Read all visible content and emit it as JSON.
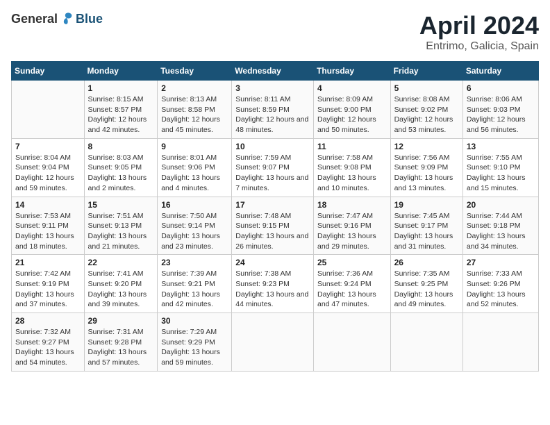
{
  "header": {
    "logo_general": "General",
    "logo_blue": "Blue",
    "title": "April 2024",
    "subtitle": "Entrimo, Galicia, Spain"
  },
  "columns": [
    "Sunday",
    "Monday",
    "Tuesday",
    "Wednesday",
    "Thursday",
    "Friday",
    "Saturday"
  ],
  "weeks": [
    [
      {
        "num": "",
        "sunrise": "",
        "sunset": "",
        "daylight": ""
      },
      {
        "num": "1",
        "sunrise": "Sunrise: 8:15 AM",
        "sunset": "Sunset: 8:57 PM",
        "daylight": "Daylight: 12 hours and 42 minutes."
      },
      {
        "num": "2",
        "sunrise": "Sunrise: 8:13 AM",
        "sunset": "Sunset: 8:58 PM",
        "daylight": "Daylight: 12 hours and 45 minutes."
      },
      {
        "num": "3",
        "sunrise": "Sunrise: 8:11 AM",
        "sunset": "Sunset: 8:59 PM",
        "daylight": "Daylight: 12 hours and 48 minutes."
      },
      {
        "num": "4",
        "sunrise": "Sunrise: 8:09 AM",
        "sunset": "Sunset: 9:00 PM",
        "daylight": "Daylight: 12 hours and 50 minutes."
      },
      {
        "num": "5",
        "sunrise": "Sunrise: 8:08 AM",
        "sunset": "Sunset: 9:02 PM",
        "daylight": "Daylight: 12 hours and 53 minutes."
      },
      {
        "num": "6",
        "sunrise": "Sunrise: 8:06 AM",
        "sunset": "Sunset: 9:03 PM",
        "daylight": "Daylight: 12 hours and 56 minutes."
      }
    ],
    [
      {
        "num": "7",
        "sunrise": "Sunrise: 8:04 AM",
        "sunset": "Sunset: 9:04 PM",
        "daylight": "Daylight: 12 hours and 59 minutes."
      },
      {
        "num": "8",
        "sunrise": "Sunrise: 8:03 AM",
        "sunset": "Sunset: 9:05 PM",
        "daylight": "Daylight: 13 hours and 2 minutes."
      },
      {
        "num": "9",
        "sunrise": "Sunrise: 8:01 AM",
        "sunset": "Sunset: 9:06 PM",
        "daylight": "Daylight: 13 hours and 4 minutes."
      },
      {
        "num": "10",
        "sunrise": "Sunrise: 7:59 AM",
        "sunset": "Sunset: 9:07 PM",
        "daylight": "Daylight: 13 hours and 7 minutes."
      },
      {
        "num": "11",
        "sunrise": "Sunrise: 7:58 AM",
        "sunset": "Sunset: 9:08 PM",
        "daylight": "Daylight: 13 hours and 10 minutes."
      },
      {
        "num": "12",
        "sunrise": "Sunrise: 7:56 AM",
        "sunset": "Sunset: 9:09 PM",
        "daylight": "Daylight: 13 hours and 13 minutes."
      },
      {
        "num": "13",
        "sunrise": "Sunrise: 7:55 AM",
        "sunset": "Sunset: 9:10 PM",
        "daylight": "Daylight: 13 hours and 15 minutes."
      }
    ],
    [
      {
        "num": "14",
        "sunrise": "Sunrise: 7:53 AM",
        "sunset": "Sunset: 9:11 PM",
        "daylight": "Daylight: 13 hours and 18 minutes."
      },
      {
        "num": "15",
        "sunrise": "Sunrise: 7:51 AM",
        "sunset": "Sunset: 9:13 PM",
        "daylight": "Daylight: 13 hours and 21 minutes."
      },
      {
        "num": "16",
        "sunrise": "Sunrise: 7:50 AM",
        "sunset": "Sunset: 9:14 PM",
        "daylight": "Daylight: 13 hours and 23 minutes."
      },
      {
        "num": "17",
        "sunrise": "Sunrise: 7:48 AM",
        "sunset": "Sunset: 9:15 PM",
        "daylight": "Daylight: 13 hours and 26 minutes."
      },
      {
        "num": "18",
        "sunrise": "Sunrise: 7:47 AM",
        "sunset": "Sunset: 9:16 PM",
        "daylight": "Daylight: 13 hours and 29 minutes."
      },
      {
        "num": "19",
        "sunrise": "Sunrise: 7:45 AM",
        "sunset": "Sunset: 9:17 PM",
        "daylight": "Daylight: 13 hours and 31 minutes."
      },
      {
        "num": "20",
        "sunrise": "Sunrise: 7:44 AM",
        "sunset": "Sunset: 9:18 PM",
        "daylight": "Daylight: 13 hours and 34 minutes."
      }
    ],
    [
      {
        "num": "21",
        "sunrise": "Sunrise: 7:42 AM",
        "sunset": "Sunset: 9:19 PM",
        "daylight": "Daylight: 13 hours and 37 minutes."
      },
      {
        "num": "22",
        "sunrise": "Sunrise: 7:41 AM",
        "sunset": "Sunset: 9:20 PM",
        "daylight": "Daylight: 13 hours and 39 minutes."
      },
      {
        "num": "23",
        "sunrise": "Sunrise: 7:39 AM",
        "sunset": "Sunset: 9:21 PM",
        "daylight": "Daylight: 13 hours and 42 minutes."
      },
      {
        "num": "24",
        "sunrise": "Sunrise: 7:38 AM",
        "sunset": "Sunset: 9:23 PM",
        "daylight": "Daylight: 13 hours and 44 minutes."
      },
      {
        "num": "25",
        "sunrise": "Sunrise: 7:36 AM",
        "sunset": "Sunset: 9:24 PM",
        "daylight": "Daylight: 13 hours and 47 minutes."
      },
      {
        "num": "26",
        "sunrise": "Sunrise: 7:35 AM",
        "sunset": "Sunset: 9:25 PM",
        "daylight": "Daylight: 13 hours and 49 minutes."
      },
      {
        "num": "27",
        "sunrise": "Sunrise: 7:33 AM",
        "sunset": "Sunset: 9:26 PM",
        "daylight": "Daylight: 13 hours and 52 minutes."
      }
    ],
    [
      {
        "num": "28",
        "sunrise": "Sunrise: 7:32 AM",
        "sunset": "Sunset: 9:27 PM",
        "daylight": "Daylight: 13 hours and 54 minutes."
      },
      {
        "num": "29",
        "sunrise": "Sunrise: 7:31 AM",
        "sunset": "Sunset: 9:28 PM",
        "daylight": "Daylight: 13 hours and 57 minutes."
      },
      {
        "num": "30",
        "sunrise": "Sunrise: 7:29 AM",
        "sunset": "Sunset: 9:29 PM",
        "daylight": "Daylight: 13 hours and 59 minutes."
      },
      {
        "num": "",
        "sunrise": "",
        "sunset": "",
        "daylight": ""
      },
      {
        "num": "",
        "sunrise": "",
        "sunset": "",
        "daylight": ""
      },
      {
        "num": "",
        "sunrise": "",
        "sunset": "",
        "daylight": ""
      },
      {
        "num": "",
        "sunrise": "",
        "sunset": "",
        "daylight": ""
      }
    ]
  ]
}
